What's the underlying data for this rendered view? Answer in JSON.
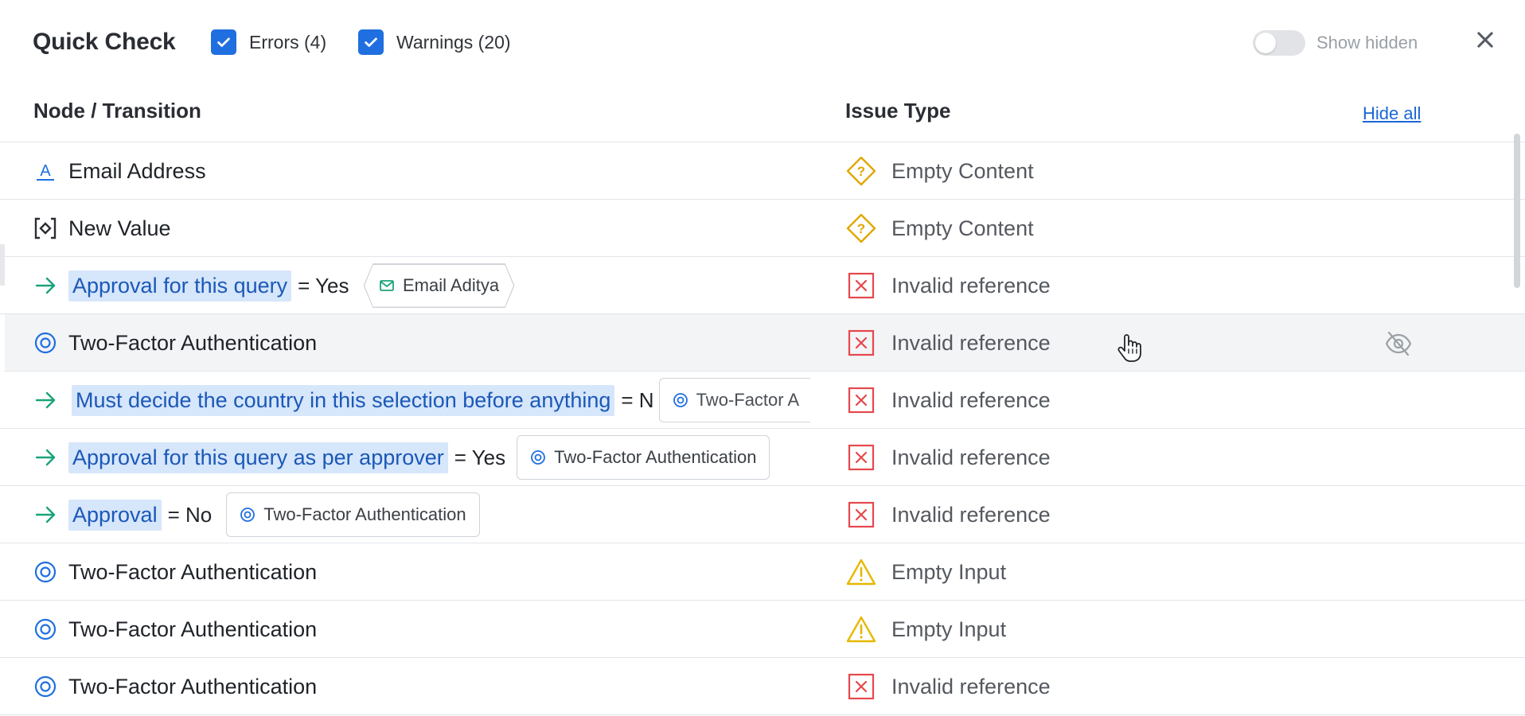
{
  "header": {
    "title": "Quick Check",
    "filters": [
      {
        "label": "Errors (4)",
        "checked": true
      },
      {
        "label": "Warnings (20)",
        "checked": true
      }
    ],
    "toggle": {
      "label": "Show hidden",
      "on": false
    },
    "close_icon": "close-icon"
  },
  "table": {
    "columns": [
      "Node / Transition",
      "Issue Type"
    ],
    "hide_all": "Hide all",
    "rows": [
      {
        "icon": "text-field-icon",
        "text": "Email Address",
        "issue_icon": "warning-diamond-icon",
        "issue": "Empty Content"
      },
      {
        "icon": "value-node-icon",
        "text": "New Value",
        "issue_icon": "warning-diamond-icon",
        "issue": "Empty Content"
      },
      {
        "icon": "arrow-right-icon",
        "highlight": "Approval for this query",
        "eq": "= Yes",
        "chip": "Email Aditya",
        "chip_icon": "mail-icon",
        "issue_icon": "error-x-icon",
        "issue": "Invalid reference"
      },
      {
        "icon": "target-icon",
        "text": "Two-Factor Authentication",
        "issue_icon": "error-x-icon",
        "issue": "Invalid reference",
        "hover_action": "eye-off-icon"
      },
      {
        "icon": "arrow-right-icon",
        "highlight": "Must decide the country in this selection before anything",
        "eq": "= N",
        "chip": "Two-Factor A",
        "chip_icon": "target-icon",
        "issue_icon": "error-x-icon",
        "issue": "Invalid reference"
      },
      {
        "icon": "arrow-right-icon",
        "highlight": "Approval for this query as per approver",
        "eq": "= Yes",
        "chip": "Two-Factor Authentication",
        "chip_icon": "target-icon",
        "issue_icon": "error-x-icon",
        "issue": "Invalid reference"
      },
      {
        "icon": "arrow-right-icon",
        "highlight": "Approval",
        "eq": "= No",
        "chip": "Two-Factor Authentication",
        "chip_icon": "target-icon",
        "issue_icon": "error-x-icon",
        "issue": "Invalid reference"
      },
      {
        "icon": "target-icon",
        "text": "Two-Factor Authentication",
        "issue_icon": "warning-triangle-icon",
        "issue": "Empty Input"
      },
      {
        "icon": "target-icon",
        "text": "Two-Factor Authentication",
        "issue_icon": "warning-triangle-icon",
        "issue": "Empty Input"
      },
      {
        "icon": "target-icon",
        "text": "Two-Factor Authentication",
        "issue_icon": "error-x-icon",
        "issue": "Invalid reference"
      }
    ]
  },
  "colors": {
    "accent": "#1f6fe0",
    "link": "#1a66d6",
    "highlight_bg": "#d6e6fb",
    "error": "#e5484d",
    "warning": "#e0a800",
    "transition": "#1aa37a"
  }
}
